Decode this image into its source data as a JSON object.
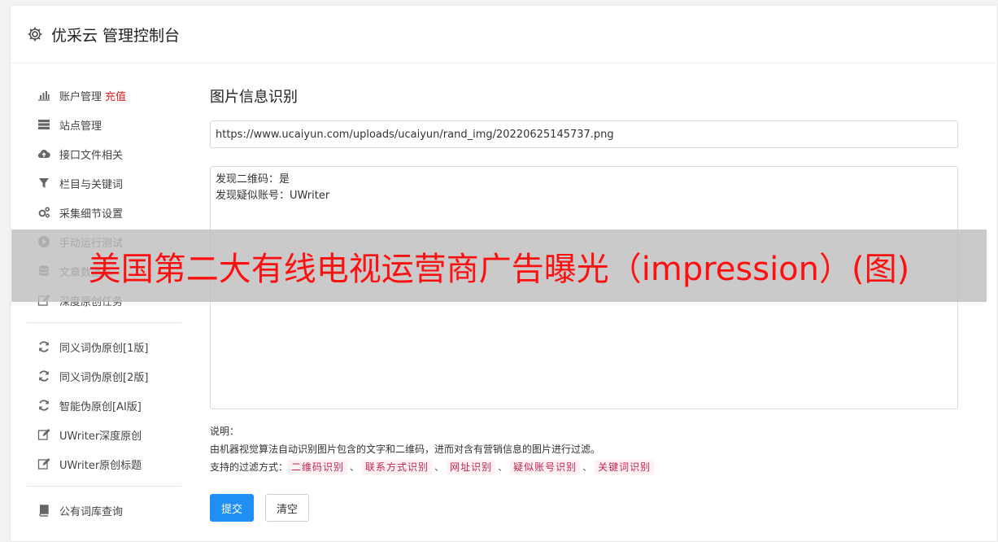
{
  "header": {
    "title": "优采云 管理控制台"
  },
  "sidebar": {
    "group1": [
      {
        "label": "账户管理",
        "extra": "充值",
        "icon": "bar-chart-icon"
      },
      {
        "label": "站点管理",
        "icon": "server-icon"
      },
      {
        "label": "接口文件相关",
        "icon": "cloud-upload-icon"
      },
      {
        "label": "栏目与关键词",
        "icon": "filter-icon"
      },
      {
        "label": "采集细节设置",
        "icon": "cogs-icon"
      },
      {
        "label": "手动运行测试",
        "icon": "play-circle-icon"
      },
      {
        "label": "文章数据库",
        "icon": "database-icon"
      },
      {
        "label": "深度原创任务",
        "icon": "edit-icon"
      }
    ],
    "group2": [
      {
        "label": "同义词伪原创[1版]",
        "icon": "refresh-icon"
      },
      {
        "label": "同义词伪原创[2版]",
        "icon": "refresh-icon"
      },
      {
        "label": "智能伪原创[AI版]",
        "icon": "refresh-icon"
      },
      {
        "label": "UWriter深度原创",
        "icon": "edit-icon"
      },
      {
        "label": "UWriter原创标题",
        "icon": "edit-icon"
      }
    ],
    "group3": [
      {
        "label": "公有词库查询",
        "icon": "book-icon"
      }
    ]
  },
  "main": {
    "title": "图片信息识别",
    "url_value": "https://www.ucaiyun.com/uploads/ucaiyun/rand_img/20220625145737.png",
    "result_text": "发现二维码：是\n发现疑似账号：UWriter",
    "desc_label": "说明：",
    "desc_text": "由机器视觉算法自动识别图片包含的文字和二维码，进而对含有营销信息的图片进行过滤。",
    "filters_label": "支持的过滤方式：",
    "filters": [
      "二维码识别",
      "联系方式识别",
      "网址识别",
      "疑似账号识别",
      "关键词识别"
    ],
    "filter_sep": "、",
    "submit_label": "提交",
    "clear_label": "清空"
  },
  "overlay": {
    "text": "美国第二大有线电视运营商广告曝光（impression）(图)"
  },
  "colors": {
    "primary": "#1e8ff5",
    "recharge": "#e02020",
    "tag_text": "#c7254e",
    "overlay_text": "#ff1010"
  }
}
